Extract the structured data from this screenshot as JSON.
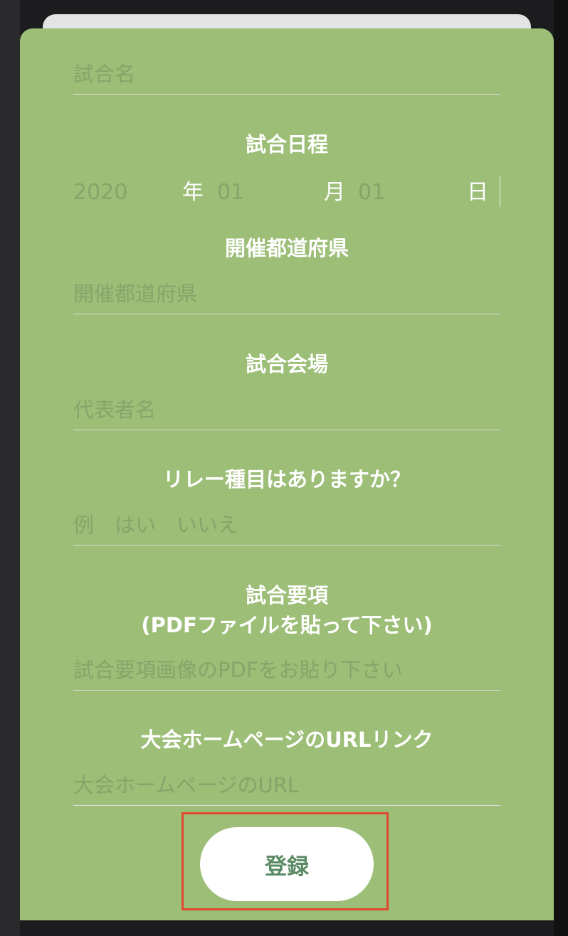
{
  "form": {
    "match_name": {
      "placeholder": "試合名"
    },
    "schedule": {
      "label": "試合日程",
      "year": "2020",
      "year_unit": "年",
      "month": "01",
      "month_unit": "月",
      "day": "01",
      "day_unit": "日"
    },
    "prefecture": {
      "label": "開催都道府県",
      "placeholder": "開催都道府県"
    },
    "venue": {
      "label": "試合会場",
      "placeholder": "代表者名"
    },
    "relay": {
      "label": "リレー種目はありますか？",
      "placeholder": "例　はい　いいえ"
    },
    "guidelines": {
      "label_line1": "試合要項",
      "label_line2": "(PDFファイルを貼って下さい)",
      "placeholder": "試合要項画像のPDFをお貼り下さい"
    },
    "homepage": {
      "label": "大会ホームページのURLリンク",
      "placeholder": "大会ホームページのURL"
    },
    "submit_label": "登録"
  }
}
